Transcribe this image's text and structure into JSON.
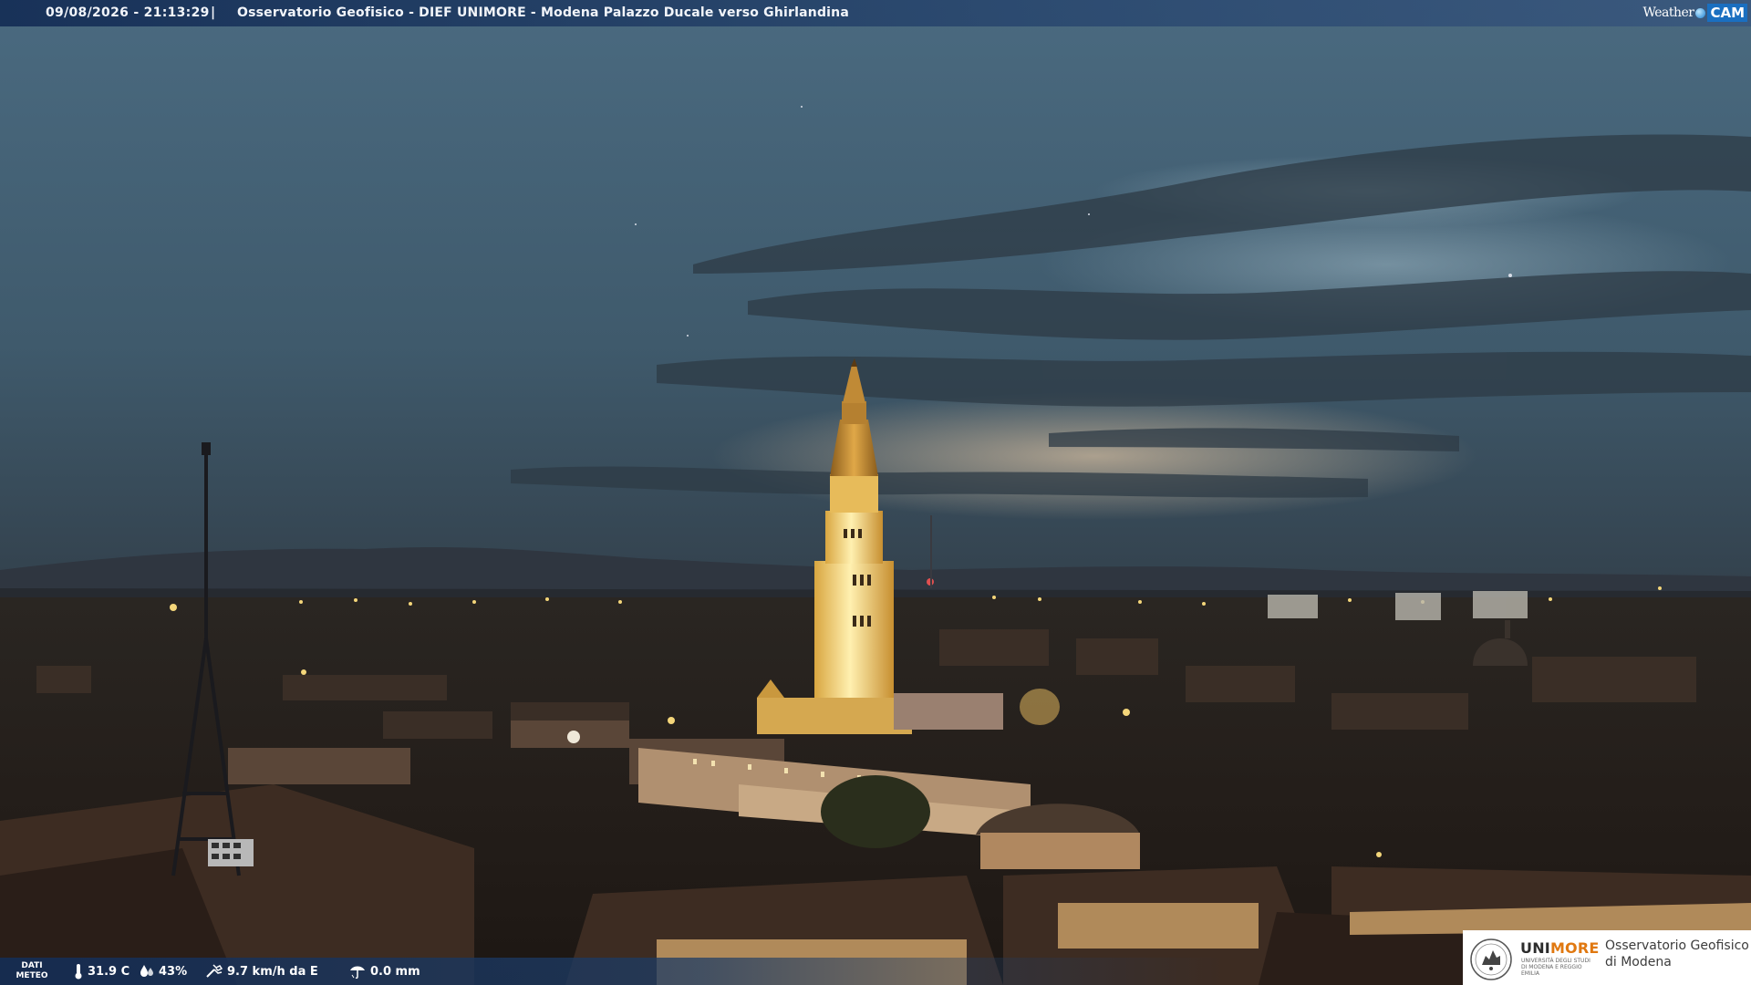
{
  "overlay": {
    "datetime": "09/08/2026 - 21:13:29",
    "separator": "|",
    "title": "Osservatorio Geofisico - DIEF UNIMORE - Modena Palazzo Ducale verso Ghirlandina"
  },
  "brand_logo": {
    "weather_text": "Weather",
    "cam_text": "CAM"
  },
  "weather_data": {
    "label_line1": "DATI",
    "label_line2": "METEO",
    "temperature": "31.9 C",
    "humidity": "43%",
    "wind": "9.7 km/h da E",
    "rain": "0.0 mm",
    "icons": [
      "thermometer-icon",
      "humidity-drop-icon",
      "wind-icon",
      "rain-gauge-icon"
    ]
  },
  "institution": {
    "name_part1": "UNI",
    "name_part2": "MORE",
    "subtitle": "UNIVERSITÀ DEGLI STUDI DI MODENA E REGGIO EMILIA",
    "observatory_line1": "Osservatorio Geofisico",
    "observatory_line2": "di Modena",
    "accent_color": "#e07810"
  },
  "colors": {
    "overlay_bar": "#1e3c64",
    "sky_top": "#4f6e84",
    "tower_light": "#f0c860"
  }
}
